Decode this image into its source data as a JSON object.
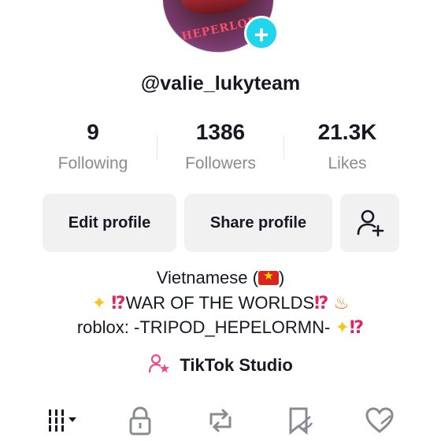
{
  "profile": {
    "avatar_text": "HEPERLOR",
    "username": "@valie_lukyteam"
  },
  "stats": [
    {
      "value": "9",
      "label": "Following"
    },
    {
      "value": "1386",
      "label": "Followers"
    },
    {
      "value": "21.3K",
      "label": "Likes"
    }
  ],
  "actions": {
    "edit_label": "Edit profile",
    "share_label": "Share profile"
  },
  "bio": {
    "line1_prefix": "Vietnamese (",
    "line1_suffix": ")",
    "line2_text": "WAR OF THE WORLDS",
    "line3_text": "roblox: -TRIPOD_HEPELORMN-"
  },
  "studio": {
    "label": "TikTok Studio"
  },
  "tabs": [
    "videos-grid-icon",
    "lock-icon",
    "repost-icon",
    "favorites-icon",
    "liked-icon"
  ],
  "colors": {
    "accent": "#20d5ec",
    "button_bg": "#f1f1f2",
    "muted_text": "#8a8b91"
  }
}
